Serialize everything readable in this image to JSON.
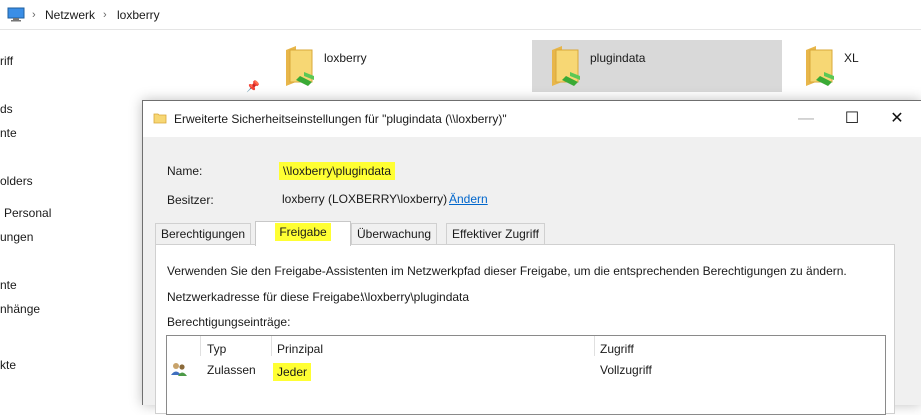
{
  "explorer": {
    "breadcrumb": [
      "Netzwerk",
      "loxberry"
    ],
    "nav_items": [
      "riff",
      "ds",
      "nte",
      "olders",
      "Personal",
      "ungen",
      "nte",
      "nhänge",
      "kte"
    ],
    "tiles": [
      {
        "label": "loxberry",
        "selected": false
      },
      {
        "label": "plugindata",
        "selected": true
      },
      {
        "label": "XL",
        "selected": false
      }
    ]
  },
  "dialog": {
    "title": "Erweiterte Sicherheitseinstellungen für \"plugindata (\\\\loxberry)\"",
    "name_label": "Name:",
    "name_value": "\\\\loxberry\\plugindata",
    "owner_label": "Besitzer:",
    "owner_value": "loxberry (LOXBERRY\\loxberry)",
    "owner_change_link": "Ändern",
    "tabs": [
      "Berechtigungen",
      "Freigabe",
      "Überwachung",
      "Effektiver Zugriff"
    ],
    "active_tab": "Freigabe",
    "panel": {
      "info_text": "Verwenden Sie den Freigabe-Assistenten im Netzwerkpfad dieser Freigabe, um die entsprechenden Berechtigungen zu ändern.",
      "netaddr_label": "Netzwerkadresse für diese Freigabe:",
      "netaddr_value": "\\\\loxberry\\plugindata",
      "entries_label": "Berechtigungseinträge:",
      "columns": [
        "Typ",
        "Prinzipal",
        "Zugriff"
      ],
      "rows": [
        {
          "typ": "Zulassen",
          "prinzipal": "Jeder",
          "zugriff": "Vollzugriff"
        }
      ]
    }
  },
  "colors": {
    "highlight": "#ffff33",
    "link": "#0066cc",
    "selected_tile": "#d9d9d9"
  }
}
